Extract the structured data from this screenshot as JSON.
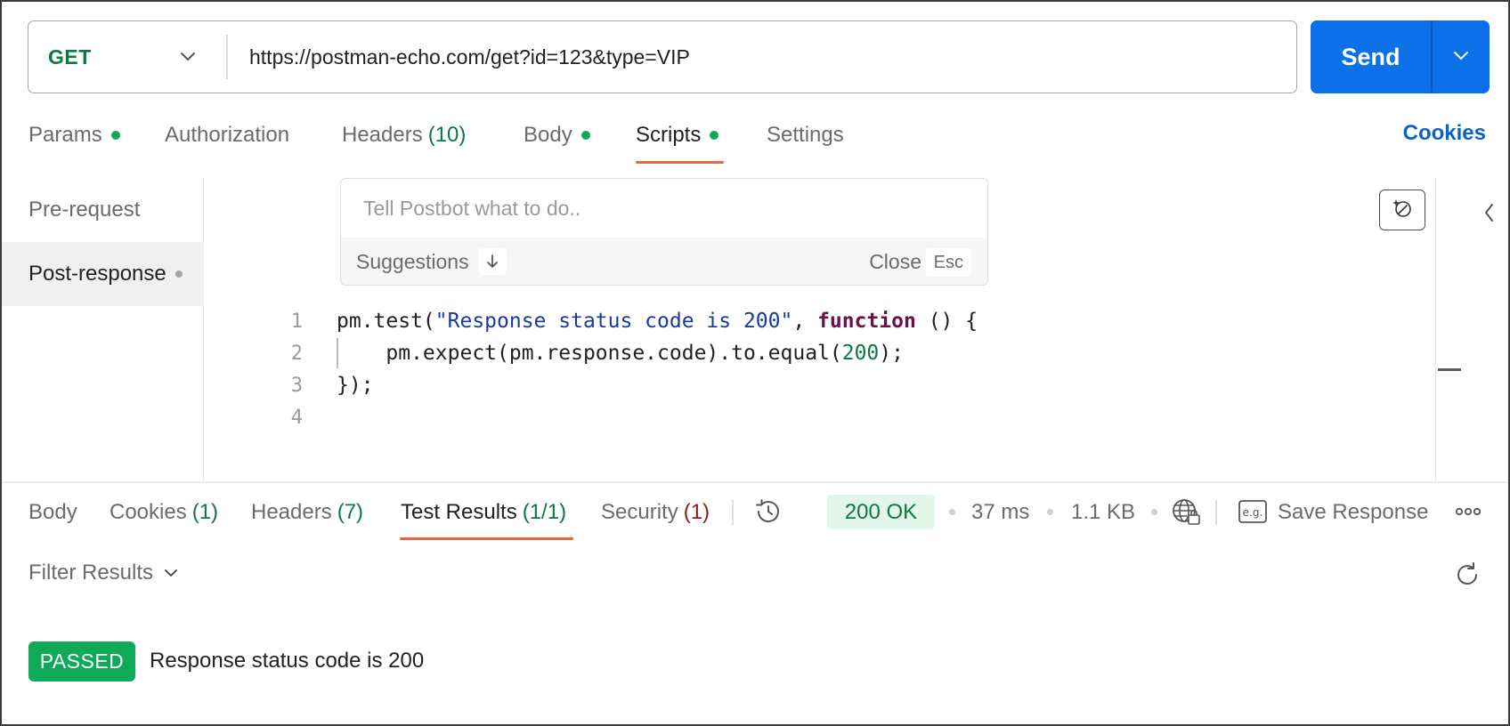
{
  "request": {
    "method": "GET",
    "url": "https://postman-echo.com/get?id=123&type=VIP",
    "send_label": "Send"
  },
  "request_tabs": [
    {
      "label": "Params",
      "count": "",
      "dot": true
    },
    {
      "label": "Authorization",
      "count": "",
      "dot": false
    },
    {
      "label": "Headers",
      "count": "(10)",
      "dot": false
    },
    {
      "label": "Body",
      "count": "",
      "dot": true
    },
    {
      "label": "Scripts",
      "count": "",
      "dot": true,
      "active": true
    },
    {
      "label": "Settings",
      "count": "",
      "dot": false
    }
  ],
  "cookies_link": "Cookies",
  "scripts": {
    "sidebar": [
      {
        "label": "Pre-request",
        "active": false
      },
      {
        "label": "Post-response",
        "active": true,
        "dot": true
      }
    ],
    "postbot": {
      "placeholder": "Tell Postbot what to do..",
      "suggestions_label": "Suggestions",
      "close_label": "Close",
      "close_key": "Esc"
    },
    "code_lines": [
      {
        "num": "1"
      },
      {
        "num": "2"
      },
      {
        "num": "3"
      },
      {
        "num": "4"
      }
    ],
    "code": {
      "l1_a": "pm.test(",
      "l1_str": "\"Response status code is 200\"",
      "l1_b": ", ",
      "l1_kw": "function",
      "l1_c": " () {",
      "l2_a": "    pm.expect(pm.response.code).to.equal(",
      "l2_num": "200",
      "l2_b": ");",
      "l3": "});",
      "l4": ""
    }
  },
  "response_tabs": [
    {
      "label": "Body",
      "count": ""
    },
    {
      "label": "Cookies",
      "count": "(1)"
    },
    {
      "label": "Headers",
      "count": "(7)"
    },
    {
      "label": "Test Results",
      "count": "(1/1)",
      "active": true
    },
    {
      "label": "Security",
      "count": "(1)",
      "count_color": "red"
    }
  ],
  "response_meta": {
    "status": "200 OK",
    "time": "37 ms",
    "size": "1.1 KB",
    "save_response": "Save Response"
  },
  "test_results": {
    "filter_label": "Filter Results",
    "results": [
      {
        "status": "PASSED",
        "name": "Response status code is 200"
      }
    ]
  },
  "colors": {
    "accent_blue": "#0c71e8",
    "method_green": "#0b7a3e",
    "tab_underline": "#e8683d",
    "passed_green": "#0fa958"
  },
  "icons": [
    "chevron-down-icon",
    "sparkle-icon",
    "chevron-left-icon",
    "history-icon",
    "globe-lock-icon",
    "example-icon",
    "more-icon",
    "refresh-icon",
    "arrow-down-icon"
  ]
}
